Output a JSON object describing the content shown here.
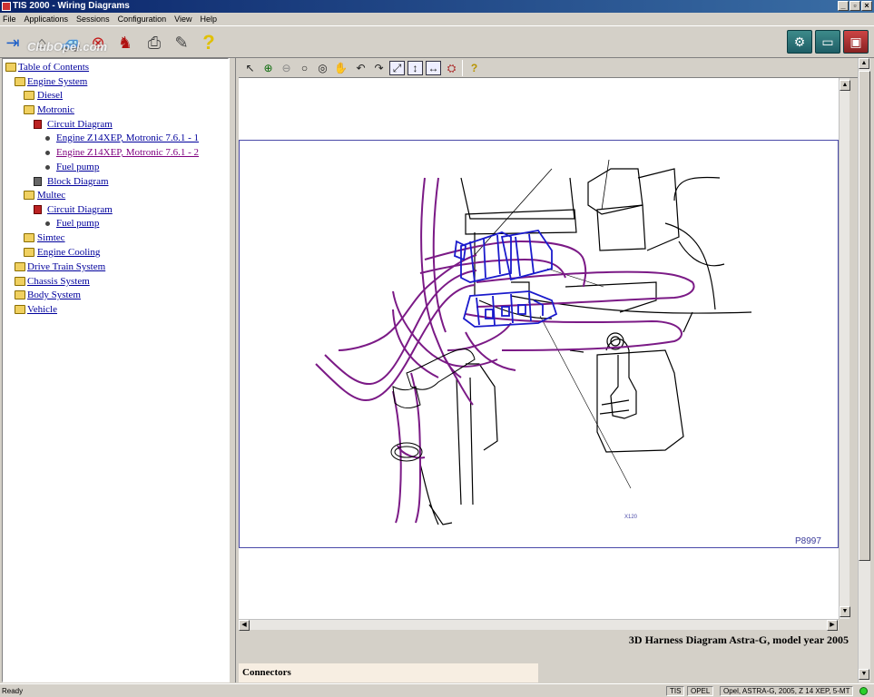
{
  "window": {
    "title": "TIS 2000 - Wiring Diagrams"
  },
  "menu": [
    "File",
    "Applications",
    "Sessions",
    "Configuration",
    "View",
    "Help"
  ],
  "watermark": "ClubOpel.com",
  "toolbar_icons": [
    "exit-icon",
    "home-icon",
    "vehicle-icon",
    "stop-icon",
    "person-icon",
    "print-icon",
    "tools-icon",
    "help-icon"
  ],
  "toolbar_right_icons": [
    "service-car-icon",
    "diagnosis-car-icon",
    "red-car-icon"
  ],
  "tree": [
    {
      "label": "Table of Contents",
      "icon": "folder-open-icon",
      "visited": false
    },
    {
      "label": "Engine System",
      "icon": "folder-open-icon",
      "visited": false
    },
    {
      "label": "Diesel",
      "icon": "folder-icon",
      "visited": false
    },
    {
      "label": "Motronic",
      "icon": "folder-open-icon",
      "visited": false
    },
    {
      "label": "Circuit Diagram",
      "icon": "book-open-icon",
      "visited": false
    },
    {
      "label": "Engine Z14XEP, Motronic 7.6.1 - 1",
      "icon": "bullet-icon",
      "visited": false
    },
    {
      "label": "Engine Z14XEP, Motronic 7.6.1 - 2",
      "icon": "bullet-icon",
      "visited": true
    },
    {
      "label": "Fuel pump",
      "icon": "bullet-icon",
      "visited": false
    },
    {
      "label": "Block Diagram",
      "icon": "book-icon",
      "visited": false
    },
    {
      "label": "Multec",
      "icon": "folder-open-icon",
      "visited": false
    },
    {
      "label": "Circuit Diagram",
      "icon": "book-open-icon",
      "visited": false
    },
    {
      "label": "Fuel pump",
      "icon": "bullet-icon",
      "visited": false
    },
    {
      "label": "Simtec",
      "icon": "folder-icon",
      "visited": false
    },
    {
      "label": "Engine Cooling",
      "icon": "folder-icon",
      "visited": false
    },
    {
      "label": "Drive Train System",
      "icon": "folder-icon",
      "visited": false
    },
    {
      "label": "Chassis System",
      "icon": "folder-icon",
      "visited": false
    },
    {
      "label": "Body System",
      "icon": "folder-icon",
      "visited": false
    },
    {
      "label": "Vehicle",
      "icon": "folder-icon",
      "visited": false
    }
  ],
  "viewer_icons": [
    "pointer-icon",
    "zoom-in-icon",
    "zoom-out-icon",
    "zoom-icon",
    "zoom-area-icon",
    "pan-icon",
    "rotate-left-icon",
    "rotate-right-icon",
    "fit-page-icon",
    "fit-height-icon",
    "fit-width-icon",
    "highlight-icon",
    "help-icon"
  ],
  "diagram": {
    "connector_label": "X120",
    "picture_number": "P8997",
    "colors": {
      "harness": "#7b1a86",
      "connector": "#1a1acc",
      "frame": "#4a4aa8"
    }
  },
  "caption": "3D Harness Diagram Astra-G, model year 2005",
  "connectors_heading": "Connectors",
  "status": {
    "ready": "Ready",
    "fields": [
      "TIS",
      "OPEL",
      "Opel, ASTRA-G, 2005, Z 14 XEP, 5-MT"
    ],
    "led_color": "#2bd02b"
  }
}
